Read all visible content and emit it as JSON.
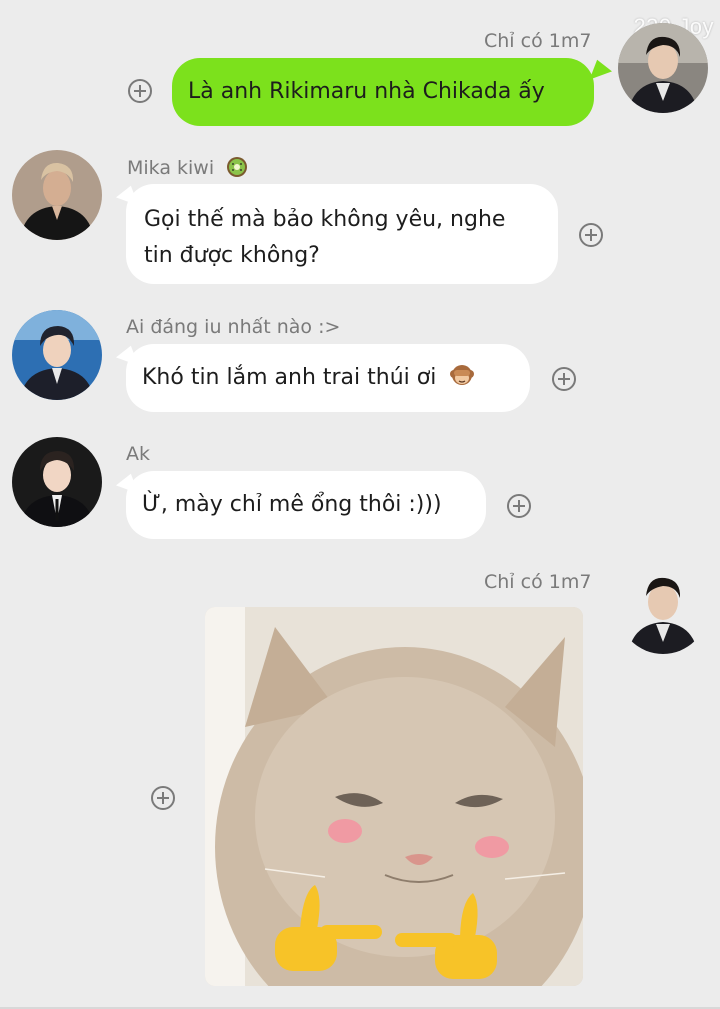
{
  "watermark": "230 Joy",
  "messages": [
    {
      "sender": "Chỉ có 1m7",
      "side": "me",
      "text": "Là anh Rikimaru nhà Chikada ấy"
    },
    {
      "sender": "Mika kiwi",
      "sender_icon": "kiwi-icon",
      "side": "other",
      "text_line1": "Gọi thế mà bảo không yêu, nghe",
      "text_line2": "tin được không?"
    },
    {
      "sender": "Ai đáng iu nhất nào :>",
      "side": "other",
      "text": "Khó tin lắm anh trai thúi ơi",
      "emoji": "see-no-evil-monkey-icon"
    },
    {
      "sender": "Ak",
      "side": "other",
      "text": "Ừ, mày chỉ mê ổng thôi :)))"
    },
    {
      "sender": "Chỉ có 1m7",
      "side": "me",
      "attachment": "cat-photo-pointing-fingers"
    }
  ],
  "colors": {
    "background": "#ececec",
    "my_bubble": "#7ce11c",
    "other_bubble": "#ffffff",
    "sender_name": "#7a7a7a"
  }
}
